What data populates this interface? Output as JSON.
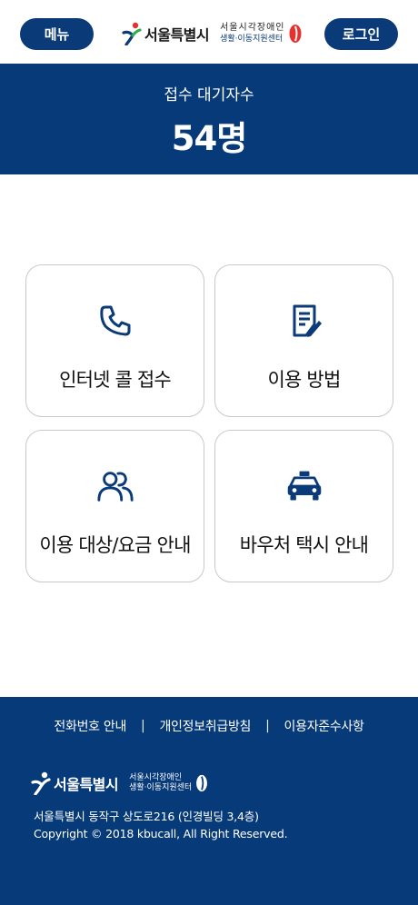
{
  "header": {
    "menu_label": "메뉴",
    "login_label": "로그인",
    "logo_city": "서울특별시",
    "logo_center_line1": "서울시각장애인",
    "logo_center_line2": "생활·이동지원센터"
  },
  "banner": {
    "label": "접수 대기자수",
    "count": "54명"
  },
  "services": [
    {
      "label": "인터넷 콜 접수",
      "icon": "phone-icon"
    },
    {
      "label": "이용 방법",
      "icon": "document-icon"
    },
    {
      "label": "이용 대상/요금 안내",
      "icon": "users-icon"
    },
    {
      "label": "바우처 택시 안내",
      "icon": "taxi-icon"
    }
  ],
  "footer": {
    "links": [
      "전화번호 안내",
      "개인정보취급방침",
      "이용자준수사항"
    ],
    "separator": "|",
    "logo_city": "서울특별시",
    "logo_center_line1": "서울시각장애인",
    "logo_center_line2": "생활·이동지원센터",
    "address": "서울특별시 동작구 상도로216 (인경빌딩 3,4층)",
    "copyright": "Copyright © 2018 kbucall, All Right Reserved."
  },
  "colors": {
    "brand_navy": "#063a78",
    "button_navy": "#0a3a78",
    "card_border": "#c9c9c9",
    "logo_red": "#e8312f",
    "logo_green": "#2fae4a"
  }
}
